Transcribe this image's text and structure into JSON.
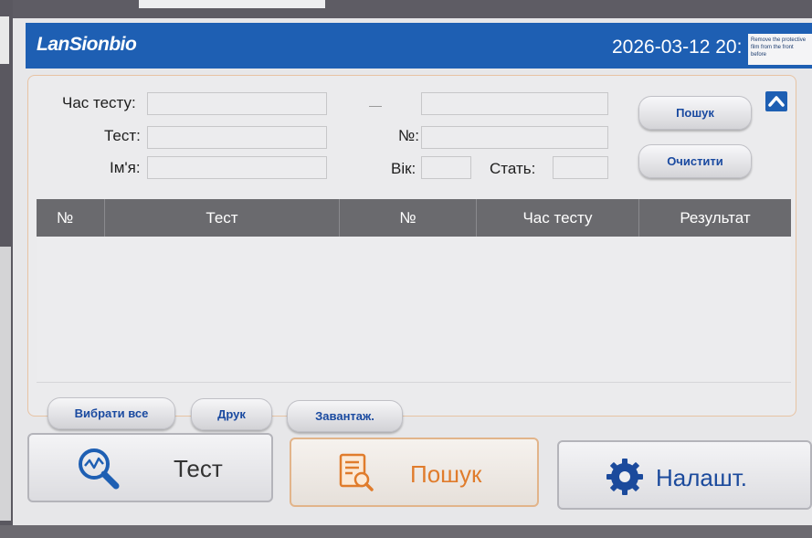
{
  "header": {
    "logo": "LanSionbio",
    "datetime": "2026-03-12 20:",
    "sticker_text": "Remove the protective film from the front before"
  },
  "filters": {
    "test_time_label": "Час тесту:",
    "test_label": "Тест:",
    "name_label": "Ім'я:",
    "number_label": "№:",
    "age_label": "Вік:",
    "sex_label": "Стать:",
    "dash": "—",
    "test_time_from": "",
    "test_time_to": "",
    "test_value": "",
    "name_value": "",
    "number_value": "",
    "age_value": "",
    "sex_value": ""
  },
  "actions": {
    "search_label": "Пошук",
    "clear_label": "Очистити"
  },
  "table": {
    "columns": [
      "№",
      "Тест",
      "№",
      "Час тесту",
      "Результат"
    ],
    "rows": []
  },
  "bottom_actions": {
    "select_all": "Вибрати все",
    "print": "Друк",
    "upload": "Завантаж."
  },
  "nav": {
    "test": {
      "label": "Тест",
      "icon": "magnifier-graph-icon"
    },
    "search": {
      "label": "Пошук",
      "icon": "document-search-icon",
      "active": true
    },
    "settings": {
      "label": "Налашт.",
      "icon": "gear-icon"
    }
  },
  "colors": {
    "header_bg": "#1e5fb3",
    "active_accent": "#e07c2c",
    "table_header_bg": "#6a6a6e",
    "button_text": "#1a4aa0"
  }
}
